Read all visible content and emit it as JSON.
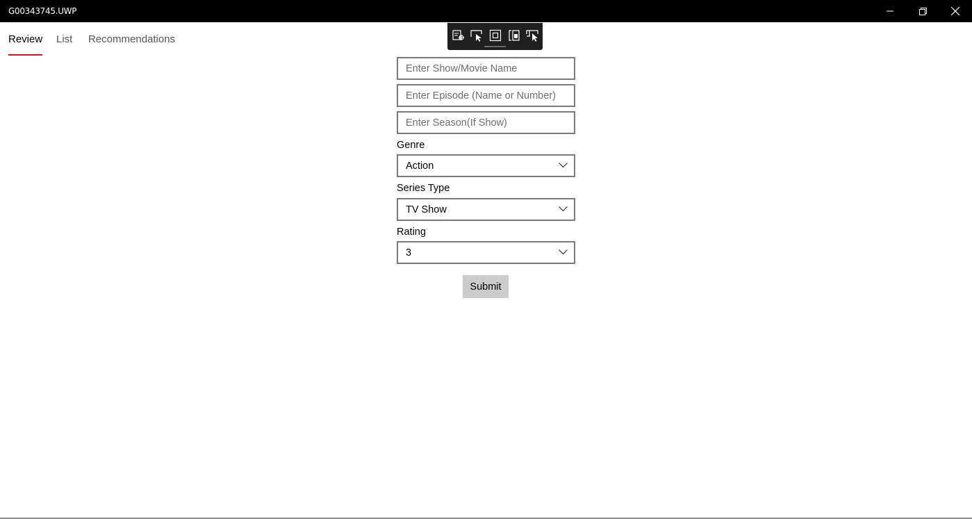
{
  "window": {
    "title": "G00343745.UWP"
  },
  "tabs": [
    {
      "label": "Review",
      "active": true
    },
    {
      "label": "List",
      "active": false
    },
    {
      "label": "Recommendations",
      "active": false
    }
  ],
  "devbar": {
    "icons": [
      "live-visual-tree-icon",
      "select-element-icon",
      "display-layout-adorners-icon",
      "track-focus-icon",
      "hot-reload-icon"
    ]
  },
  "form": {
    "name_placeholder": "Enter Show/Movie Name",
    "name_value": "",
    "episode_placeholder": "Enter Episode (Name or Number)",
    "episode_value": "",
    "season_placeholder": "Enter Season(If Show)",
    "season_value": "",
    "genre_label": "Genre",
    "genre_value": "Action",
    "series_type_label": "Series Type",
    "series_type_value": "TV Show",
    "rating_label": "Rating",
    "rating_value": "3",
    "submit_label": "Submit"
  },
  "colors": {
    "titlebar": "#000000",
    "accent": "#e81123",
    "border": "#7a7a7a",
    "button": "#cccccc"
  }
}
